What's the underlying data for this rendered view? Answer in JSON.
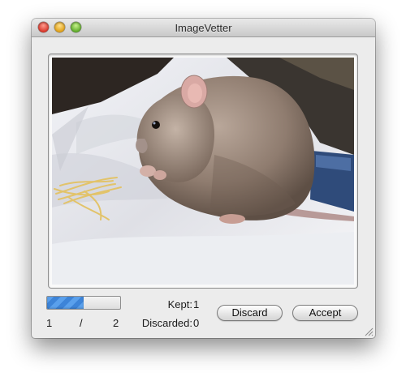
{
  "window": {
    "title": "ImageVetter"
  },
  "photo": {
    "subject": "rat-photo"
  },
  "progress": {
    "fraction": 0.5,
    "current": "1",
    "separator": "/",
    "total": "2"
  },
  "stats": {
    "kept_label": "Kept:",
    "kept_value": "1",
    "discarded_label": "Discarded:",
    "discarded_value": "0"
  },
  "buttons": {
    "discard_label": "Discard",
    "accept_label": "Accept"
  },
  "colors": {
    "progress_fill": "#4a8fe0",
    "window_bg": "#ececec"
  }
}
